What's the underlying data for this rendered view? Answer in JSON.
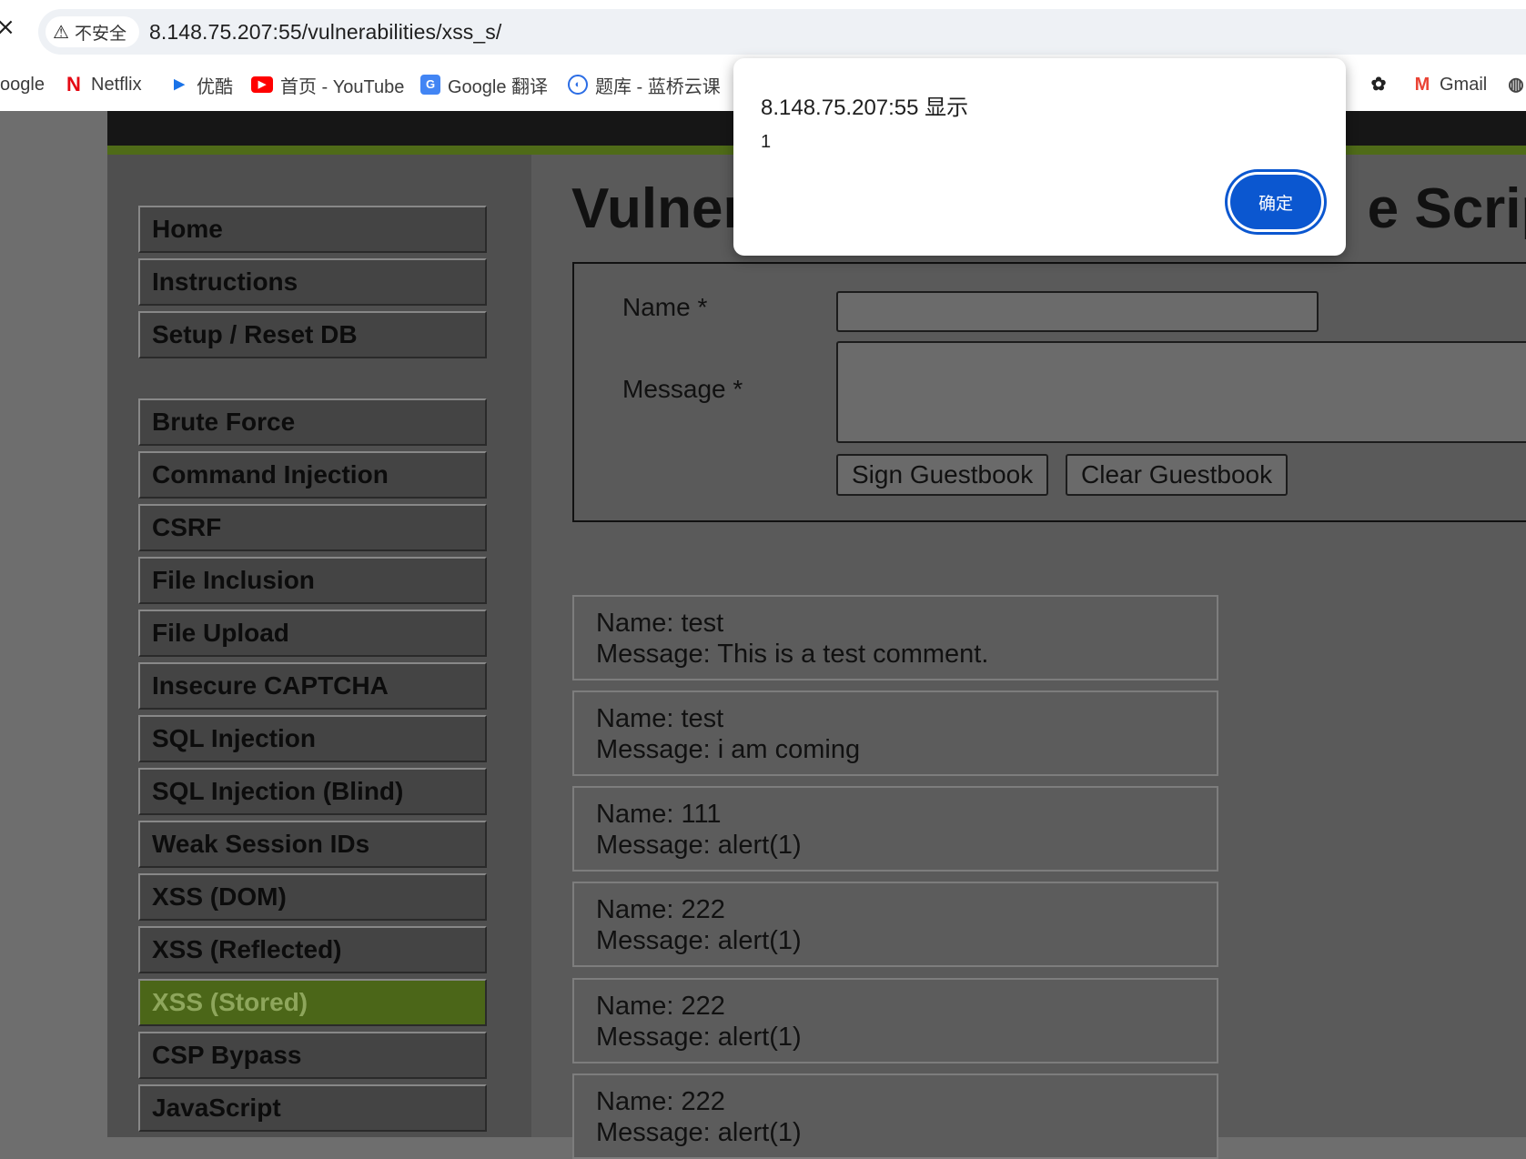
{
  "browser": {
    "security_label": "不安全",
    "url": "8.148.75.207:55/vulnerabilities/xss_s/",
    "bookmarks": [
      {
        "label": "oogle",
        "icon": "google-icon"
      },
      {
        "label": "Netflix",
        "icon": "netflix-icon",
        "color": "#e50914"
      },
      {
        "label": "优酷",
        "icon": "youku-icon",
        "color": "#1a73e8"
      },
      {
        "label": "首页 - YouTube",
        "icon": "youtube-icon",
        "color": "#ff0000"
      },
      {
        "label": "Google 翻译",
        "icon": "google-translate-icon",
        "color": "#4285f4"
      },
      {
        "label": "题库 - 蓝桥云课",
        "icon": "lanqiao-icon",
        "color": "#2b6de5"
      },
      {
        "label": "",
        "icon": "openai-icon"
      },
      {
        "label": "Gmail",
        "icon": "gmail-icon",
        "color": "#ea4335"
      },
      {
        "label": "",
        "icon": "globe-icon"
      }
    ]
  },
  "sidebar": {
    "group1": [
      "Home",
      "Instructions",
      "Setup / Reset DB"
    ],
    "group2": [
      "Brute Force",
      "Command Injection",
      "CSRF",
      "File Inclusion",
      "File Upload",
      "Insecure CAPTCHA",
      "SQL Injection",
      "SQL Injection (Blind)",
      "Weak Session IDs",
      "XSS (DOM)",
      "XSS (Reflected)",
      "XSS (Stored)",
      "CSP Bypass",
      "JavaScript"
    ],
    "selected": "XSS (Stored)"
  },
  "main": {
    "title_left": "Vulner",
    "title_right": "e Script",
    "form": {
      "name_label": "Name *",
      "message_label": "Message *",
      "name_value": "",
      "message_value": "",
      "sign_button": "Sign Guestbook",
      "clear_button": "Clear Guestbook"
    },
    "entries": [
      {
        "name": "Name: test",
        "message": "Message: This is a test comment."
      },
      {
        "name": "Name: test",
        "message": "Message: i am coming"
      },
      {
        "name": "Name: 111",
        "message": "Message: alert(1)"
      },
      {
        "name": "Name: 222",
        "message": "Message: alert(1)"
      },
      {
        "name": "Name: 222",
        "message": "Message: alert(1)"
      },
      {
        "name": "Name: 222",
        "message": "Message: alert(1)"
      }
    ]
  },
  "alert": {
    "origin": "8.148.75.207:55 显示",
    "message": "1",
    "ok_label": "确定"
  },
  "colors": {
    "accent_green": "#4b6618",
    "alert_button": "#0b57d0"
  }
}
